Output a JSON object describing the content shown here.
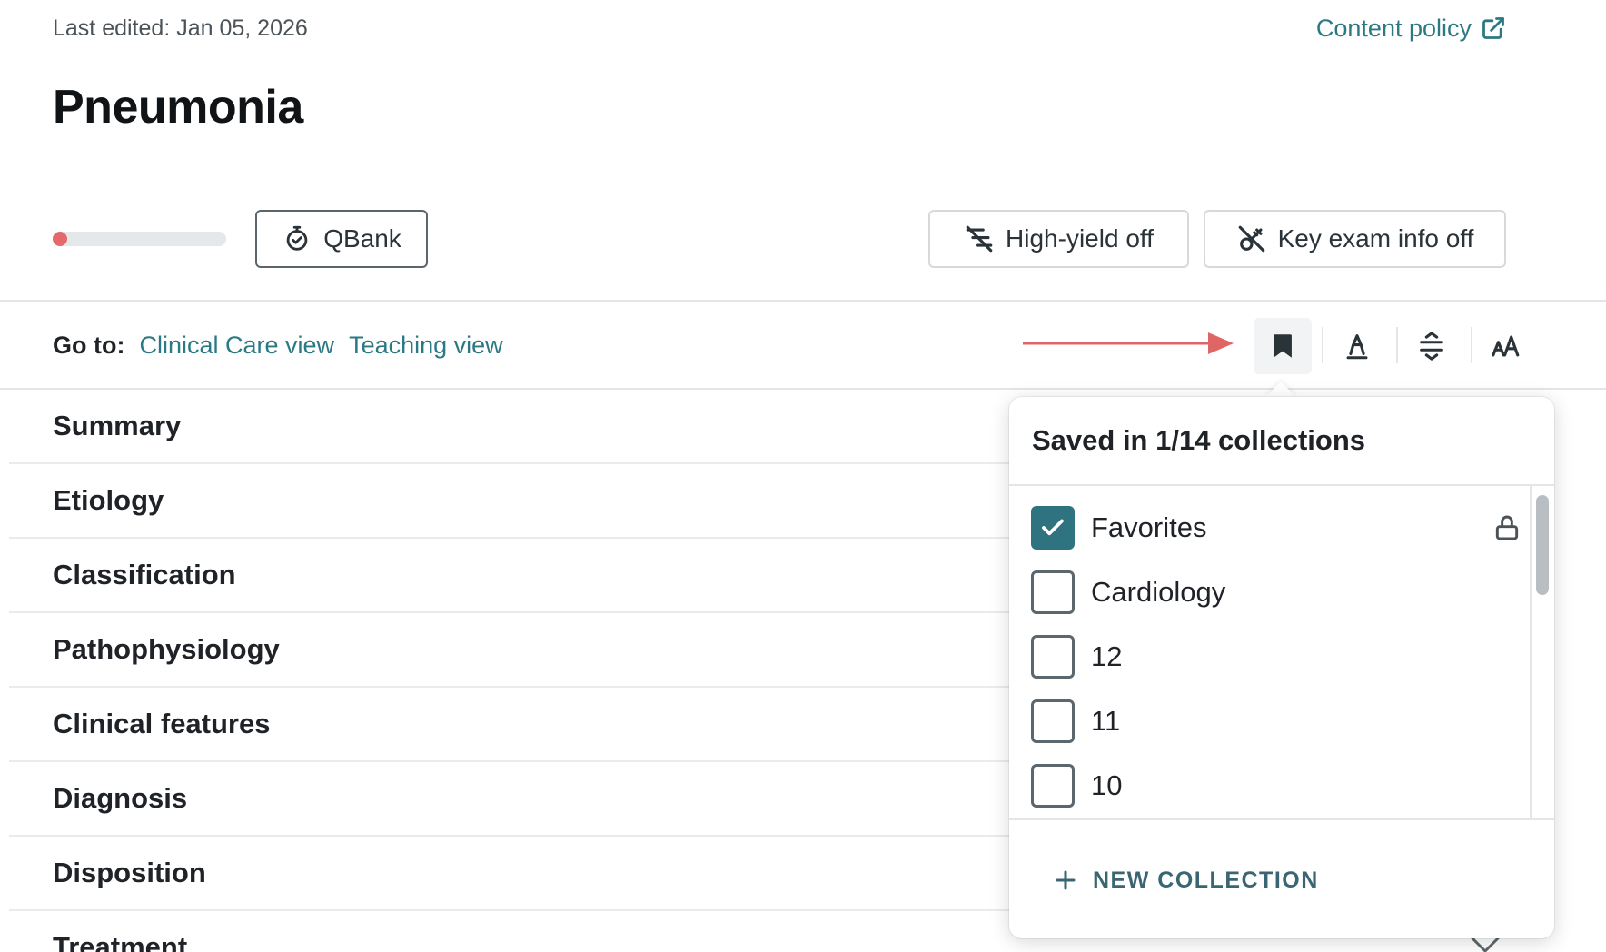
{
  "header": {
    "last_edited": "Last edited: Jan 05, 2026",
    "content_policy": "Content policy",
    "title": "Pneumonia"
  },
  "progress": {
    "percent": 0
  },
  "actions": {
    "qbank": "QBank",
    "high_yield": "High-yield off",
    "key_exam": "Key exam info off"
  },
  "goto": {
    "label": "Go to:",
    "links": [
      "Clinical Care view",
      "Teaching view"
    ]
  },
  "toolbar": {
    "icons": [
      "bookmark-icon",
      "highlighter-icon",
      "line-spacing-icon",
      "font-size-icon"
    ]
  },
  "sections": [
    "Summary",
    "Etiology",
    "Classification",
    "Pathophysiology",
    "Clinical features",
    "Diagnosis",
    "Disposition",
    "Treatment"
  ],
  "collections_popover": {
    "title": "Saved in 1/14 collections",
    "items": [
      {
        "label": "Favorites",
        "checked": true,
        "locked": true
      },
      {
        "label": "Cardiology",
        "checked": false
      },
      {
        "label": "12",
        "checked": false
      },
      {
        "label": "11",
        "checked": false
      },
      {
        "label": "10",
        "checked": false
      }
    ],
    "new_collection": "NEW COLLECTION"
  },
  "colors": {
    "accent": "#2b7a83",
    "checkbox_checked": "#2f7380",
    "progress_dot": "#e5696a",
    "annotation_arrow": "#e06666"
  }
}
